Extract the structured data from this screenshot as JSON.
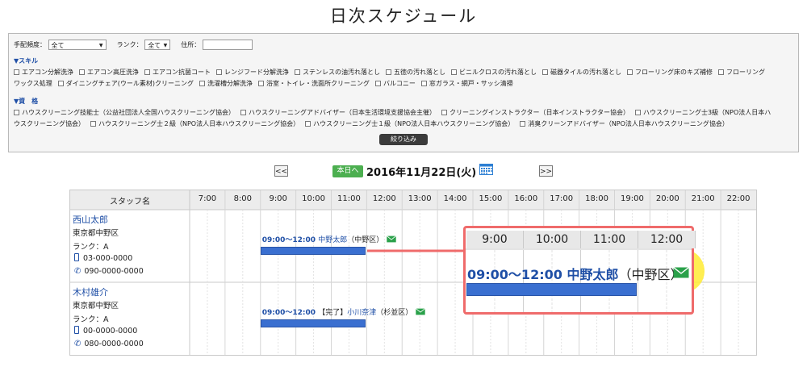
{
  "title": "日次スケジュール",
  "filters": {
    "frequency_label": "手配頻度：",
    "frequency_value": "全て",
    "rank_label": "ランク：",
    "rank_value": "全て",
    "address_label": "住所：",
    "address_value": "",
    "skill_heading": "▼スキル",
    "skills_row1": [
      "エアコン分解洗浄",
      "エアコン高圧洗浄",
      "エアコン抗菌コート",
      "レンジフード分解洗浄",
      "ステンレスの油汚れ落とし",
      "五徳の汚れ落とし",
      "ビニルクロスの汚れ落とし",
      "磁器タイルの汚れ落とし",
      "フローリング床のキズ補修"
    ],
    "skill_wrap_a": "フローリング",
    "skill_wrap_b": "ワックス処理",
    "skills_row2": [
      "ダイニングチェア(ウール素材)クリーニング",
      "洗濯槽分解洗浄",
      "浴室・トイレ・洗面所クリーニング",
      "バルコニー",
      "窓ガラス・網戸・サッシ清掃"
    ],
    "license_heading": "▼資　格",
    "licenses_row1": [
      "ハウスクリーニング技能士（公益社団法人全国ハウスクリーニング協会）",
      "ハウスクリーニングアドバイザー（日本生活環境支援協会主催）",
      "クリーニングインストラクター（日本インストラクター協会）"
    ],
    "license_wrap_a": "ハウスクリーニング士3級（NPO法人日本ハ",
    "license_wrap_b": "ウスクリーニング協会）",
    "licenses_row2": [
      "ハウスクリーニング士２級（NPO法人日本ハウスクリーニング協会）",
      "ハウスクリーニング士１級（NPO法人日本ハウスクリーニング協会）",
      "消臭クリーンアドバイザー（NPO法人日本ハウスクリーニング協会）"
    ],
    "submit_label": "絞り込み"
  },
  "nav": {
    "prev_label": "<<",
    "next_label": ">>",
    "today_label": "本日へ",
    "date": "2016年11月22日(火)"
  },
  "schedule": {
    "staff_header": "スタッフ名",
    "hours": [
      "7:00",
      "8:00",
      "9:00",
      "10:00",
      "11:00",
      "12:00",
      "13:00",
      "14:00",
      "15:00",
      "16:00",
      "17:00",
      "18:00",
      "19:00",
      "20:00",
      "21:00",
      "22:00"
    ],
    "staff": [
      {
        "name": "西山太郎",
        "address": "東京都中野区",
        "rank": "ランク：A",
        "phone": "03-000-0000",
        "mobile": "090-0000-0000",
        "event": {
          "time": "09:00〜12:00",
          "status": "",
          "customer": "中野太郎",
          "ward": "（中野区）",
          "start": 9,
          "end": 12
        }
      },
      {
        "name": "木村雄介",
        "address": "東京都中野区",
        "rank": "ランク：A",
        "phone": "00-0000-0000",
        "mobile": "080-0000-0000",
        "event": {
          "time": "09:00〜12:00",
          "status": "【完了】",
          "customer": "小川奈津",
          "ward": "（杉並区）",
          "start": 9,
          "end": 12
        }
      }
    ]
  },
  "zoom": {
    "hours": [
      "9:00",
      "10:00",
      "11:00",
      "12:00"
    ],
    "time": "09:00〜12:00",
    "customer": "中野太郎",
    "ward": "（中野区）"
  },
  "colors": {
    "link": "#1f4fa6",
    "bar": "#3a6fd0",
    "today": "#4caf50",
    "highlight": "#ef6b6b",
    "mail": "#2aa14a"
  }
}
